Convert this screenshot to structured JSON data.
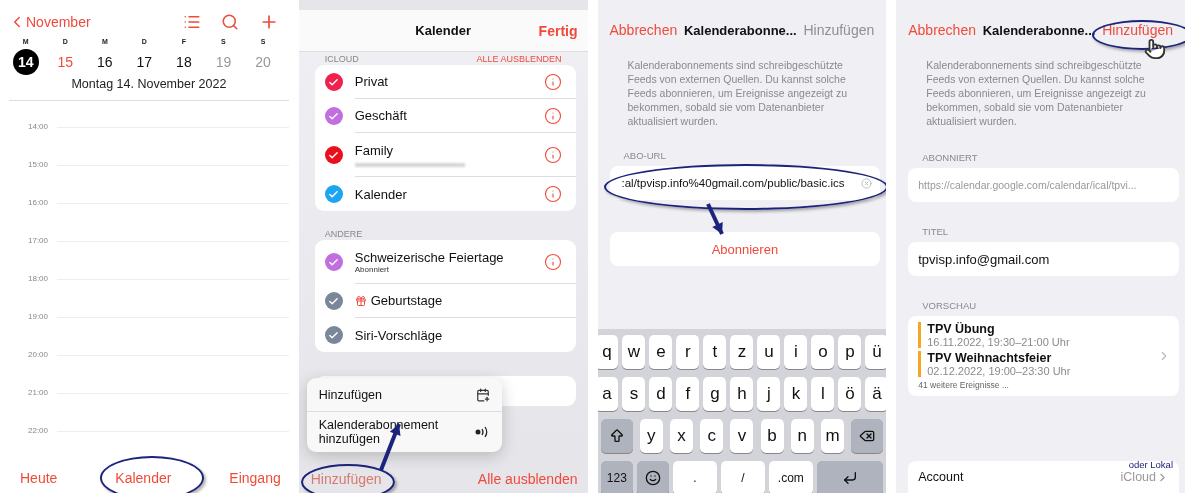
{
  "day_view": {
    "back": "November",
    "days": [
      {
        "letter": "M",
        "day": "14",
        "kind": "selected"
      },
      {
        "letter": "D",
        "day": "15",
        "kind": "today"
      },
      {
        "letter": "M",
        "day": "16",
        "kind": "weekday"
      },
      {
        "letter": "D",
        "day": "17",
        "kind": "weekday"
      },
      {
        "letter": "F",
        "day": "18",
        "kind": "weekday"
      },
      {
        "letter": "S",
        "day": "19",
        "kind": "weekend"
      },
      {
        "letter": "S",
        "day": "20",
        "kind": "weekend"
      }
    ],
    "date_title": "Montag  14. November 2022",
    "hours": [
      "14:00",
      "15:00",
      "16:00",
      "17:00",
      "18:00",
      "19:00",
      "20:00",
      "21:00",
      "22:00"
    ],
    "toolbar": [
      "Heute",
      "Kalender",
      "Eingang"
    ]
  },
  "calendar_list": {
    "title": "Kalender",
    "done": "Fertig",
    "sections": [
      {
        "header": "ICLOUD",
        "action": "ALLE AUSBLENDEN",
        "items": [
          {
            "name": "Privat",
            "color": "#f0204f",
            "kind": "plain",
            "info": true
          },
          {
            "name": "Geschäft",
            "color": "#c06ee0",
            "kind": "plain",
            "info": true
          },
          {
            "name": "Family",
            "color": "#e8101c",
            "kind": "redacted",
            "info": true
          },
          {
            "name": "Kalender",
            "color": "#1ea5f0",
            "kind": "plain",
            "info": true
          }
        ]
      },
      {
        "header": "ANDERE",
        "items": [
          {
            "name": "Schweizerische Feiertage",
            "subtitle": "Abonniert",
            "color": "#c06ee0",
            "kind": "plain",
            "info": true
          },
          {
            "name": "Geburtstage",
            "color": "#7a8799",
            "kind": "birthdays",
            "info": false
          },
          {
            "name": "Siri-Vorschläge",
            "color": "#7a8799",
            "kind": "plain",
            "info": false
          }
        ]
      }
    ],
    "menu": [
      {
        "label": "Hinzufügen",
        "kind": "calendar"
      },
      {
        "label": "Kalenderabonnement hinzufügen",
        "kind": "subscription"
      }
    ],
    "add": "Hinzufügen",
    "hide_all": "Alle ausblenden"
  },
  "subscription_form": {
    "cancel": "Abbrechen",
    "title": "Kalenderabonne...",
    "add": {
      "label": "Hinzufügen",
      "disabled": true
    },
    "description": "Kalenderabonnements sind schreibgeschützte Feeds von externen Quellen. Du kannst solche Feeds abonnieren, um Ereignisse angezeigt zu bekommen, sobald sie vom Datenanbieter aktualisiert wurden.",
    "url_label": "ABO-URL",
    "url_value": ":al/tpvisp.info%40gmail.com/public/basic.ics",
    "subscribe": "Abonnieren",
    "keyboard": [
      [
        {
          "kind": "char",
          "label": "q"
        },
        {
          "kind": "char",
          "label": "w"
        },
        {
          "kind": "char",
          "label": "e"
        },
        {
          "kind": "char",
          "label": "r"
        },
        {
          "kind": "char",
          "label": "t"
        },
        {
          "kind": "char",
          "label": "z"
        },
        {
          "kind": "char",
          "label": "u"
        },
        {
          "kind": "char",
          "label": "i"
        },
        {
          "kind": "char",
          "label": "o"
        },
        {
          "kind": "char",
          "label": "p"
        },
        {
          "kind": "char",
          "label": "ü"
        }
      ],
      [
        {
          "kind": "char",
          "label": "a"
        },
        {
          "kind": "char",
          "label": "s"
        },
        {
          "kind": "char",
          "label": "d"
        },
        {
          "kind": "char",
          "label": "f"
        },
        {
          "kind": "char",
          "label": "g"
        },
        {
          "kind": "char",
          "label": "h"
        },
        {
          "kind": "char",
          "label": "j"
        },
        {
          "kind": "char",
          "label": "k"
        },
        {
          "kind": "char",
          "label": "l"
        },
        {
          "kind": "char",
          "label": "ö"
        },
        {
          "kind": "char",
          "label": "ä"
        }
      ],
      [
        {
          "kind": "shift"
        },
        {
          "kind": "char",
          "label": "y"
        },
        {
          "kind": "char",
          "label": "x"
        },
        {
          "kind": "char",
          "label": "c"
        },
        {
          "kind": "char",
          "label": "v"
        },
        {
          "kind": "char",
          "label": "b"
        },
        {
          "kind": "char",
          "label": "n"
        },
        {
          "kind": "char",
          "label": "m"
        },
        {
          "kind": "backspace"
        }
      ],
      [
        {
          "kind": "numbers",
          "label": "123"
        },
        {
          "kind": "emoji"
        },
        {
          "kind": "wide",
          "label": "."
        },
        {
          "kind": "wide",
          "label": "/"
        },
        {
          "kind": "wide",
          "label": ".com"
        },
        {
          "kind": "return"
        }
      ]
    ]
  },
  "subscription_details": {
    "cancel": "Abbrechen",
    "title": "Kalenderabonne...",
    "add": {
      "label": "Hinzufügen",
      "disabled": false
    },
    "description": "Kalenderabonnements sind schreibgeschützte Feeds von externen Quellen. Du kannst solche Feeds abonnieren, um Ereignisse angezeigt zu bekommen, sobald sie vom Datenanbieter aktualisiert wurden.",
    "subscribed_label": "ABONNIERT",
    "subscribed_url": "https://calendar.google.com/calendar/ical/tpvi...",
    "title_label": "TITEL",
    "title_value": "tpvisp.info@gmail.com",
    "preview_label": "VORSCHAU",
    "events": [
      {
        "title": "TPV Übung",
        "time": "16.11.2022, 19:30–21:00 Uhr",
        "color": "#f5a623"
      },
      {
        "title": "TPV Weihnachtsfeier",
        "time": "02.12.2022, 19:00–23:30 Uhr",
        "color": "#f5a623"
      }
    ],
    "more": "41 weitere Ereignisse ...",
    "account_label": "Account",
    "account_value": "iCloud",
    "note": "oder Lokal"
  }
}
